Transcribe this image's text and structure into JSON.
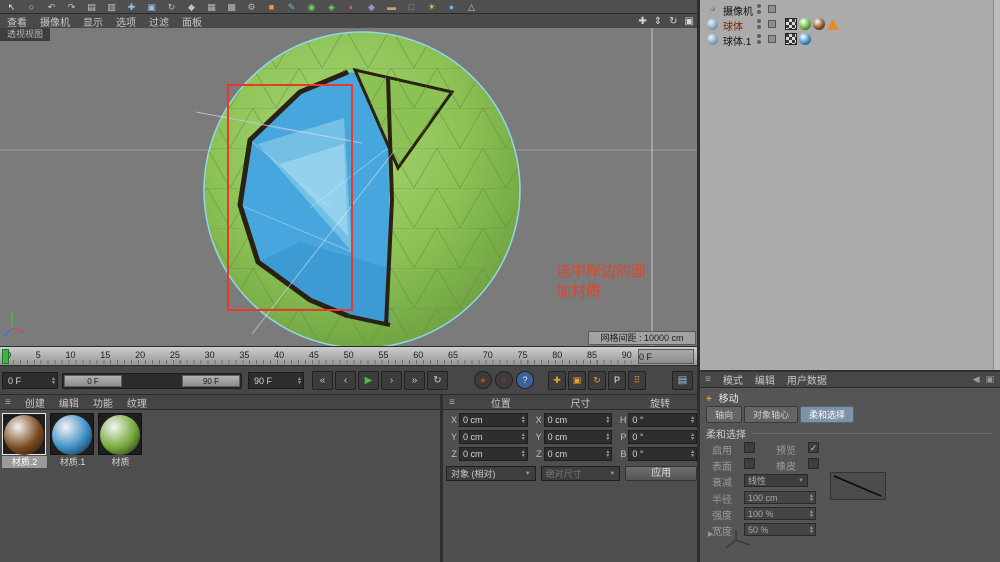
{
  "colors": {
    "selection_red": "#e8392a",
    "annotation_red": "#e0442a",
    "sphere_green": "#8cc155",
    "sphere_blue": "#46a6dd",
    "active_tab_blue": "#7e93aa",
    "playhead_green": "#3db44a"
  },
  "top_toolbar": {
    "icons": [
      {
        "n": "select-arrow-icon",
        "g": "↖",
        "c": "#ececec"
      },
      {
        "n": "live-selection-icon",
        "g": "○",
        "c": "#d8d8d8"
      },
      {
        "n": "undo-icon",
        "g": "↶",
        "c": "#c4c4c4"
      },
      {
        "n": "redo-icon",
        "g": "↷",
        "c": "#c4c4c4"
      },
      {
        "n": "copy-icon",
        "g": "▤",
        "c": "#c4c4c4"
      },
      {
        "n": "paste-icon",
        "g": "▥",
        "c": "#c4c4c4"
      },
      {
        "n": "move-tool-icon",
        "g": "✚",
        "c": "#9cc0e8"
      },
      {
        "n": "scale-tool-icon",
        "g": "▣",
        "c": "#9cc0e8"
      },
      {
        "n": "rotate-tool-icon",
        "g": "↻",
        "c": "#9cc0e8"
      },
      {
        "n": "coordinate-system-icon",
        "g": "◆",
        "c": "#c4c4c4"
      },
      {
        "n": "render-view-icon",
        "g": "▦",
        "c": "#b8b8b8"
      },
      {
        "n": "render-picture-icon",
        "g": "▩",
        "c": "#b8b8b8"
      },
      {
        "n": "render-settings-icon",
        "g": "⚙",
        "c": "#b8b8b8"
      },
      {
        "n": "primitive-cube-icon",
        "g": "■",
        "c": "#e8a038"
      },
      {
        "n": "spline-pen-icon",
        "g": "✎",
        "c": "#68b8e0"
      },
      {
        "n": "subdivision-surface-icon",
        "g": "◉",
        "c": "#78c868"
      },
      {
        "n": "array-icon",
        "g": "◈",
        "c": "#78c868"
      },
      {
        "n": "boole-icon",
        "g": "◐",
        "c": "#d87848"
      },
      {
        "n": "deformer-icon",
        "g": "◆",
        "c": "#b088d8"
      },
      {
        "n": "floor-icon",
        "g": "▬",
        "c": "#c8a060"
      },
      {
        "n": "camera-tool-icon",
        "g": "□",
        "c": "#a8a8a8"
      },
      {
        "n": "light-icon",
        "g": "☀",
        "c": "#e8d048"
      },
      {
        "n": "sky-icon",
        "g": "●",
        "c": "#78aad8"
      },
      {
        "n": "stage-icon",
        "g": "△",
        "c": "#c8c8c8"
      }
    ]
  },
  "viewport": {
    "menus": [
      "查看",
      "摄像机",
      "显示",
      "选项",
      "过滤",
      "面板"
    ],
    "nav_icons": [
      {
        "n": "pan-view-icon",
        "g": "✚"
      },
      {
        "n": "zoom-view-icon",
        "g": "⇕"
      },
      {
        "n": "rotate-view-icon",
        "g": "↻"
      },
      {
        "n": "maximize-view-icon",
        "g": "▣"
      }
    ],
    "view_label": "透视视图",
    "grid_info": "网格间距 : 10000 cm",
    "annotation": {
      "line1": "选中岸边的面",
      "line2": "加材质"
    }
  },
  "timeline": {
    "ticks": [
      "0",
      "5",
      "10",
      "15",
      "20",
      "25",
      "30",
      "35",
      "40",
      "45",
      "50",
      "55",
      "60",
      "65",
      "70",
      "75",
      "80",
      "85",
      "90"
    ],
    "current_frame_box": "0 F",
    "frame_start_spinner": "0 F",
    "range_start_label": "0 F",
    "range_end_label": "90 F",
    "frame_end_spinner": "90 F",
    "playback_icons": [
      {
        "n": "goto-start-button",
        "g": "«"
      },
      {
        "n": "prev-key-button",
        "g": "‹"
      },
      {
        "n": "play-button",
        "g": "▶",
        "c": "#45c045"
      },
      {
        "n": "next-key-button",
        "g": "›"
      },
      {
        "n": "goto-end-button",
        "g": "»"
      },
      {
        "n": "loop-button",
        "g": "↻"
      }
    ],
    "record_icons": [
      {
        "n": "record-keyframe-button",
        "g": "●",
        "c": "#d23c28"
      },
      {
        "n": "autokey-button",
        "g": "○",
        "c": "#d23c28"
      },
      {
        "n": "help-button",
        "g": "?",
        "c": "#e8f0f8",
        "bg": "#3c6298"
      }
    ],
    "key_icons": [
      {
        "n": "key-position-button",
        "g": "✚"
      },
      {
        "n": "key-scale-button",
        "g": "▣"
      },
      {
        "n": "key-rotation-button",
        "g": "↻"
      },
      {
        "n": "key-parameter-button",
        "g": "P",
        "c": "#e8e8e8"
      },
      {
        "n": "key-pla-button",
        "g": "⠿"
      }
    ],
    "layout_toggle": {
      "n": "layout-toggle-button",
      "g": "▤",
      "c": "#9cc8e8"
    }
  },
  "object_manager": {
    "items": [
      {
        "label": "摄像机",
        "chips": []
      },
      {
        "label": "球体",
        "chips": [
          {
            "t": "checker"
          },
          {
            "t": "sphere",
            "c": "#6cb83e"
          },
          {
            "t": "sphere",
            "c": "#8a5a2a"
          },
          {
            "t": "warn"
          }
        ]
      },
      {
        "label": "球体.1",
        "chips": [
          {
            "t": "checker"
          },
          {
            "t": "sphere",
            "c": "#4693c8"
          }
        ]
      }
    ]
  },
  "materials": {
    "menus": [
      "创建",
      "编辑",
      "功能",
      "纹理"
    ],
    "items": [
      {
        "name": "材质.2",
        "c": "#7a4a20",
        "sel": "selected"
      },
      {
        "name": "材质.1",
        "c": "#3e8ec6"
      },
      {
        "name": "材质",
        "c": "#74a83a"
      }
    ]
  },
  "coordinates": {
    "headers": [
      "位置",
      "尺寸",
      "旋转"
    ],
    "rows": [
      {
        "l1": "X",
        "v1": "0 cm",
        "l2": "X",
        "v2": "0 cm",
        "l3": "H",
        "v3": "0 °"
      },
      {
        "l1": "Y",
        "v1": "0 cm",
        "l2": "Y",
        "v2": "0 cm",
        "l3": "P",
        "v3": "0 °"
      },
      {
        "l1": "Z",
        "v1": "0 cm",
        "l2": "Z",
        "v2": "0 cm",
        "l3": "B",
        "v3": "0 °"
      }
    ],
    "mode_dropdown": "对象 (相对)",
    "size_dropdown": "绝对尺寸",
    "apply_button": "应用"
  },
  "attributes": {
    "menus": [
      "模式",
      "编辑",
      "用户数据"
    ],
    "tool_title": "移动",
    "tabs": [
      "轴向",
      "对象轴心",
      "柔和选择"
    ],
    "active_tab": "柔和选择",
    "section_title": "柔和选择",
    "enable_label": "启用",
    "preview_label": "预览",
    "preview_checked": "✓",
    "surface_label": "表面",
    "eraser_label": "橡皮",
    "falloff_label": "衰减",
    "falloff_value": "线性",
    "sliders": [
      {
        "label": "半径",
        "value": "100 cm"
      },
      {
        "label": "强度",
        "value": "100 %"
      },
      {
        "label": "宽度",
        "value": "50 %"
      }
    ]
  }
}
